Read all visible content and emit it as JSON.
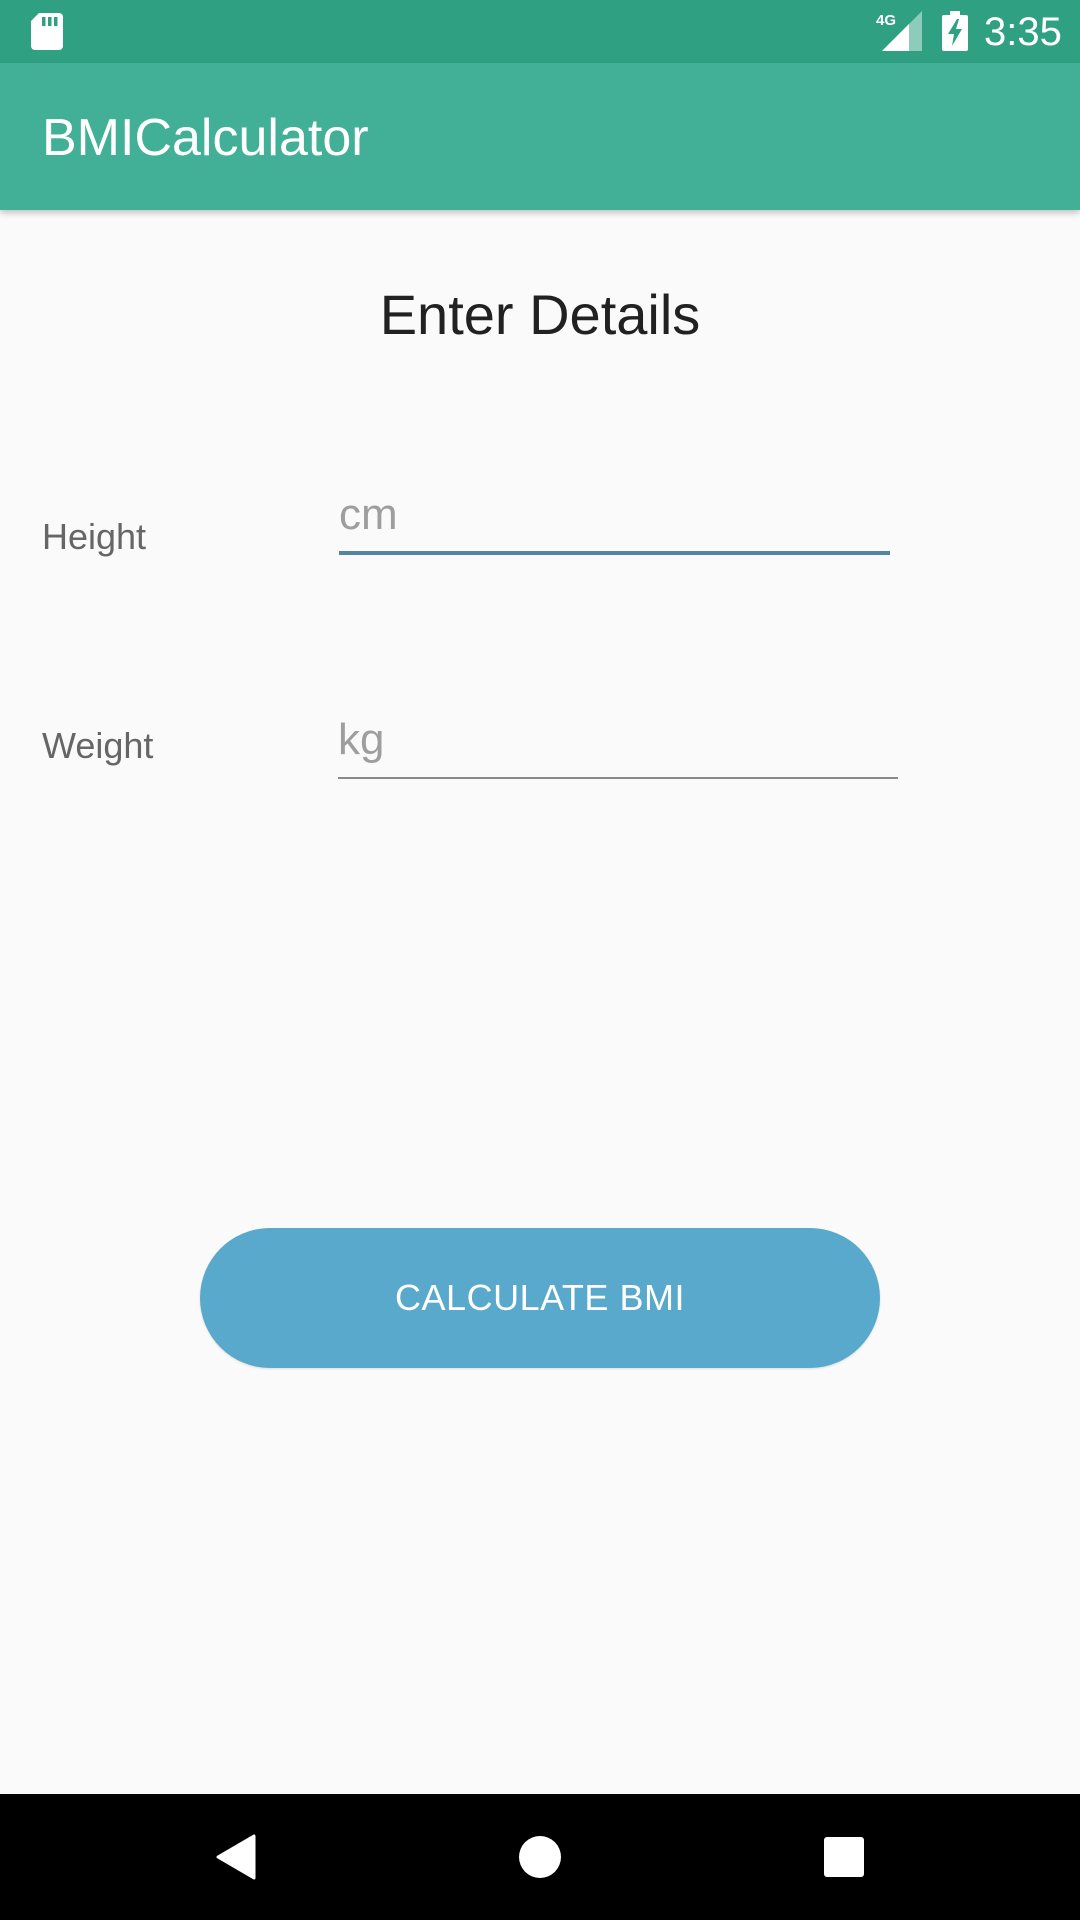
{
  "status_bar": {
    "time": "3:35",
    "network": "4G",
    "icons": [
      "sd-card-icon",
      "signal-4g-icon",
      "battery-charging-icon"
    ]
  },
  "app_bar": {
    "title": "BMICalculator"
  },
  "form": {
    "heading": "Enter Details",
    "height": {
      "label": "Height",
      "value": "",
      "placeholder": "cm"
    },
    "weight": {
      "label": "Weight",
      "value": "",
      "placeholder": "kg"
    },
    "submit_label": "CALCULATE BMI"
  },
  "nav_bar": {
    "icons": [
      "back-icon",
      "home-icon",
      "recents-icon"
    ]
  },
  "colors": {
    "status_bar": "#30a083",
    "app_bar": "#41b097",
    "button": "#58a9cb",
    "focused_underline": "#5585a1",
    "unfocused_underline": "#8a8a8a",
    "background": "#fafafa"
  }
}
